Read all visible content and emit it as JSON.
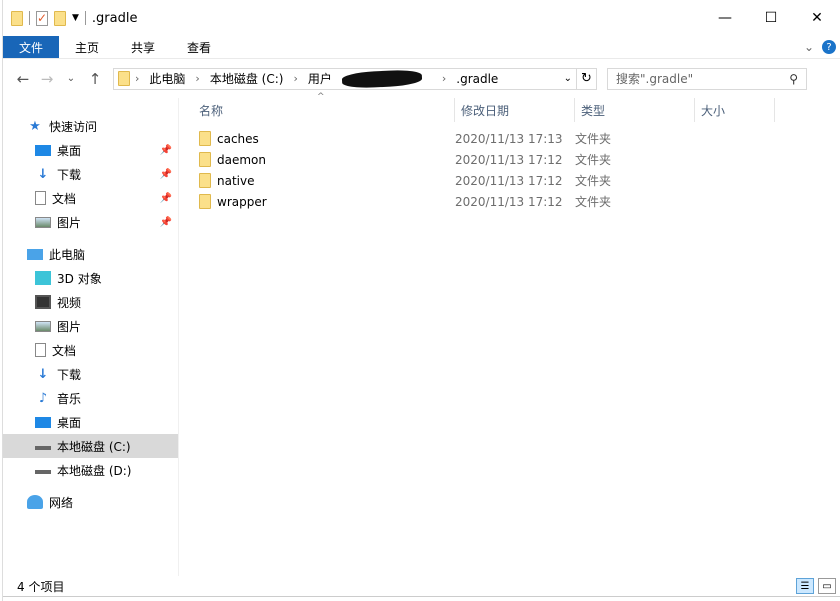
{
  "window": {
    "title": ".gradle"
  },
  "ribbon": {
    "tabs": [
      "文件",
      "主页",
      "共享",
      "查看"
    ]
  },
  "address": {
    "crumbs": [
      "此电脑",
      "本地磁盘 (C:)",
      "用户",
      ".gradle"
    ]
  },
  "search": {
    "placeholder": "搜索\".gradle\""
  },
  "sidebar": {
    "quick_access": "快速访问",
    "quick_items": [
      {
        "label": "桌面",
        "icon": "desktop-icon"
      },
      {
        "label": "下载",
        "icon": "download-icon"
      },
      {
        "label": "文档",
        "icon": "document-icon"
      },
      {
        "label": "图片",
        "icon": "picture-icon"
      }
    ],
    "this_pc": "此电脑",
    "pc_items": [
      {
        "label": "3D 对象",
        "icon": "cube-icon"
      },
      {
        "label": "视频",
        "icon": "video-icon"
      },
      {
        "label": "图片",
        "icon": "picture-icon"
      },
      {
        "label": "文档",
        "icon": "document-icon"
      },
      {
        "label": "下载",
        "icon": "download-icon"
      },
      {
        "label": "音乐",
        "icon": "music-icon"
      },
      {
        "label": "桌面",
        "icon": "desktop-icon"
      },
      {
        "label": "本地磁盘 (C:)",
        "icon": "drive-c-icon",
        "selected": true
      },
      {
        "label": "本地磁盘 (D:)",
        "icon": "drive-icon"
      }
    ],
    "network": "网络"
  },
  "columns": [
    "名称",
    "修改日期",
    "类型",
    "大小"
  ],
  "files": [
    {
      "name": "caches",
      "date": "2020/11/13 17:13",
      "type": "文件夹"
    },
    {
      "name": "daemon",
      "date": "2020/11/13 17:12",
      "type": "文件夹"
    },
    {
      "name": "native",
      "date": "2020/11/13 17:12",
      "type": "文件夹"
    },
    {
      "name": "wrapper",
      "date": "2020/11/13 17:12",
      "type": "文件夹"
    }
  ],
  "status": {
    "count": "4 个项目"
  },
  "colors": {
    "accent": "#1966b8",
    "selected": "#d9d9d9"
  }
}
